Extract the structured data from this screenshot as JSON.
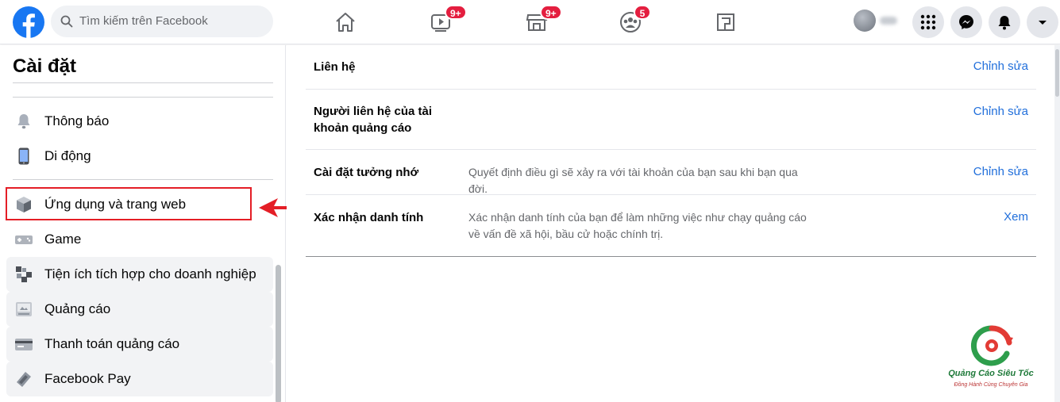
{
  "topbar": {
    "search_placeholder": "Tìm kiếm trên Facebook",
    "watch_badge": "9+",
    "marketplace_badge": "9+",
    "groups_badge": "5"
  },
  "sidebar": {
    "title": "Cài đặt",
    "items": [
      {
        "label": "Thông báo",
        "icon": "bell-icon"
      },
      {
        "label": "Di động",
        "icon": "mobile-icon"
      },
      {
        "label": "Ứng dụng và trang web",
        "icon": "cube-icon"
      },
      {
        "label": "Game",
        "icon": "game-icon"
      },
      {
        "label": "Tiện ích tích hợp cho doanh nghiệp",
        "icon": "puzzle-icon"
      },
      {
        "label": "Quảng cáo",
        "icon": "ads-icon"
      },
      {
        "label": "Thanh toán quảng cáo",
        "icon": "card-icon"
      },
      {
        "label": "Facebook Pay",
        "icon": "pay-icon"
      }
    ],
    "highlighted_index": 2
  },
  "main": {
    "rows": [
      {
        "label": "Liên hệ",
        "description": "",
        "action": "Chỉnh sửa"
      },
      {
        "label": "Người liên hệ của tài khoản quảng cáo",
        "description": "",
        "action": "Chỉnh sửa"
      },
      {
        "label": "Cài đặt tưởng nhớ",
        "description": "Quyết định điều gì sẽ xảy ra với tài khoản của bạn sau khi bạn qua đời.",
        "action": "Chỉnh sửa"
      },
      {
        "label": "Xác nhận danh tính",
        "description": "Xác nhận danh tính của bạn để làm những việc như chạy quảng cáo về vấn đề xã hội, bầu cử hoặc chính trị.",
        "action": "Xem"
      }
    ]
  },
  "watermark": {
    "brand": "Quảng Cáo Siêu Tốc",
    "tagline": "Đồng Hành Cùng Chuyên Gia"
  },
  "colors": {
    "facebook_blue": "#1877f2",
    "link_blue": "#216fdb",
    "highlight_red": "#e41e26",
    "badge_red": "#e41e3f"
  }
}
